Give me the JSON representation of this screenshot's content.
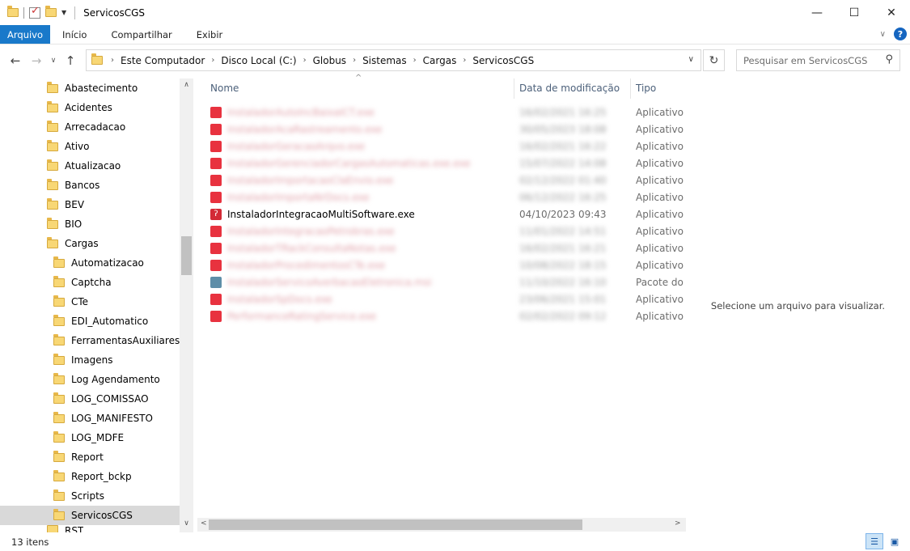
{
  "window": {
    "title": "ServicosCGS",
    "minimize_glyph": "—",
    "maximize_glyph": "☐",
    "close_glyph": "✕"
  },
  "ribbon": {
    "tabs": [
      "Arquivo",
      "Início",
      "Compartilhar",
      "Exibir"
    ],
    "collapse_glyph": "∨",
    "help_glyph": "?"
  },
  "address": {
    "back_glyph": "←",
    "forward_glyph": "→",
    "recent_glyph": "∨",
    "up_glyph": "↑",
    "breadcrumbs": [
      "Este Computador",
      "Disco Local (C:)",
      "Globus",
      "Sistemas",
      "Cargas",
      "ServicosCGS"
    ],
    "crumb_separator": "›",
    "dropdown_glyph": "∨",
    "refresh_glyph": "↻",
    "search_placeholder": "Pesquisar em ServicosCGS",
    "search_glyph": "⚲"
  },
  "nav": {
    "top_level": [
      "Abastecimento",
      "Acidentes",
      "Arrecadacao",
      "Ativo",
      "Atualizacao",
      "Bancos",
      "BEV",
      "BIO",
      "Cargas"
    ],
    "children": [
      "Automatizacao",
      "Captcha",
      "CTe",
      "EDI_Automatico",
      "FerramentasAuxiliares",
      "Imagens",
      "Log Agendamento",
      "LOG_COMISSAO",
      "LOG_MANIFESTO",
      "LOG_MDFE",
      "Report",
      "Report_bckp",
      "Scripts",
      "ServicosCGS"
    ],
    "selected": "ServicosCGS",
    "partial_next": "RST",
    "scroll_up_glyph": "∧",
    "scroll_down_glyph": "∨"
  },
  "columns": {
    "name": "Nome",
    "date": "Data de modificação",
    "type": "Tipo",
    "sort_glyph": "^"
  },
  "files": [
    {
      "name": "InstaladorAutoIncBaixaICT.exe",
      "date": "16/02/2021 16:25",
      "type": "Aplicativo",
      "blurred": true,
      "icon": "exe"
    },
    {
      "name": "InstaladorAcaRastreamento.exe",
      "date": "30/05/2023 18:08",
      "type": "Aplicativo",
      "blurred": true,
      "icon": "exe"
    },
    {
      "name": "InstaladorGeracaoArqvo.exe",
      "date": "16/02/2021 16:22",
      "type": "Aplicativo",
      "blurred": true,
      "icon": "exe"
    },
    {
      "name": "InstaladorGerenciadorCargasAutomaticas.exe.exe",
      "date": "15/07/2022 14:08",
      "type": "Aplicativo",
      "blurred": true,
      "icon": "exe"
    },
    {
      "name": "InstaladorImportacaoClaEnvio.exe",
      "date": "02/12/2022 01:40",
      "type": "Aplicativo",
      "blurred": true,
      "icon": "exe"
    },
    {
      "name": "InstaladorImportaNrDocs.exe",
      "date": "06/12/2022 16:25",
      "type": "Aplicativo",
      "blurred": true,
      "icon": "exe"
    },
    {
      "name": "InstaladorIntegracaoMultiSoftware.exe",
      "date": "04/10/2023 09:43",
      "type": "Aplicativo",
      "blurred": false,
      "icon": "real"
    },
    {
      "name": "InstaladorIntegracaoPetrobras.exe",
      "date": "11/01/2022 14:51",
      "type": "Aplicativo",
      "blurred": true,
      "icon": "exe"
    },
    {
      "name": "InstaladorTRackConsultaNotas.exe",
      "date": "16/02/2021 16:21",
      "type": "Aplicativo",
      "blurred": true,
      "icon": "exe"
    },
    {
      "name": "InstaladorProcedimentosCTe.exe",
      "date": "10/08/2022 18:15",
      "type": "Aplicativo",
      "blurred": true,
      "icon": "exe"
    },
    {
      "name": "InstaladorServicoAverbacaoEletronica.msi",
      "date": "11/10/2022 16:10",
      "type": "Pacote do Windows",
      "blurred": true,
      "icon": "msi"
    },
    {
      "name": "InstaladorSpDocs.exe",
      "date": "23/06/2021 15:01",
      "type": "Aplicativo",
      "blurred": true,
      "icon": "exe"
    },
    {
      "name": "PerformanceRatingService.exe",
      "date": "02/02/2022 09:12",
      "type": "Aplicativo",
      "blurred": true,
      "icon": "exe"
    }
  ],
  "preview": {
    "text": "Selecione um arquivo para visualizar."
  },
  "status": {
    "count": "13 itens",
    "details_view_glyph": "☰",
    "large_icons_view_glyph": "▣"
  },
  "colors": {
    "accent": "#1979ca",
    "selection": "#d9d9d9",
    "header_text": "#4c607a"
  }
}
